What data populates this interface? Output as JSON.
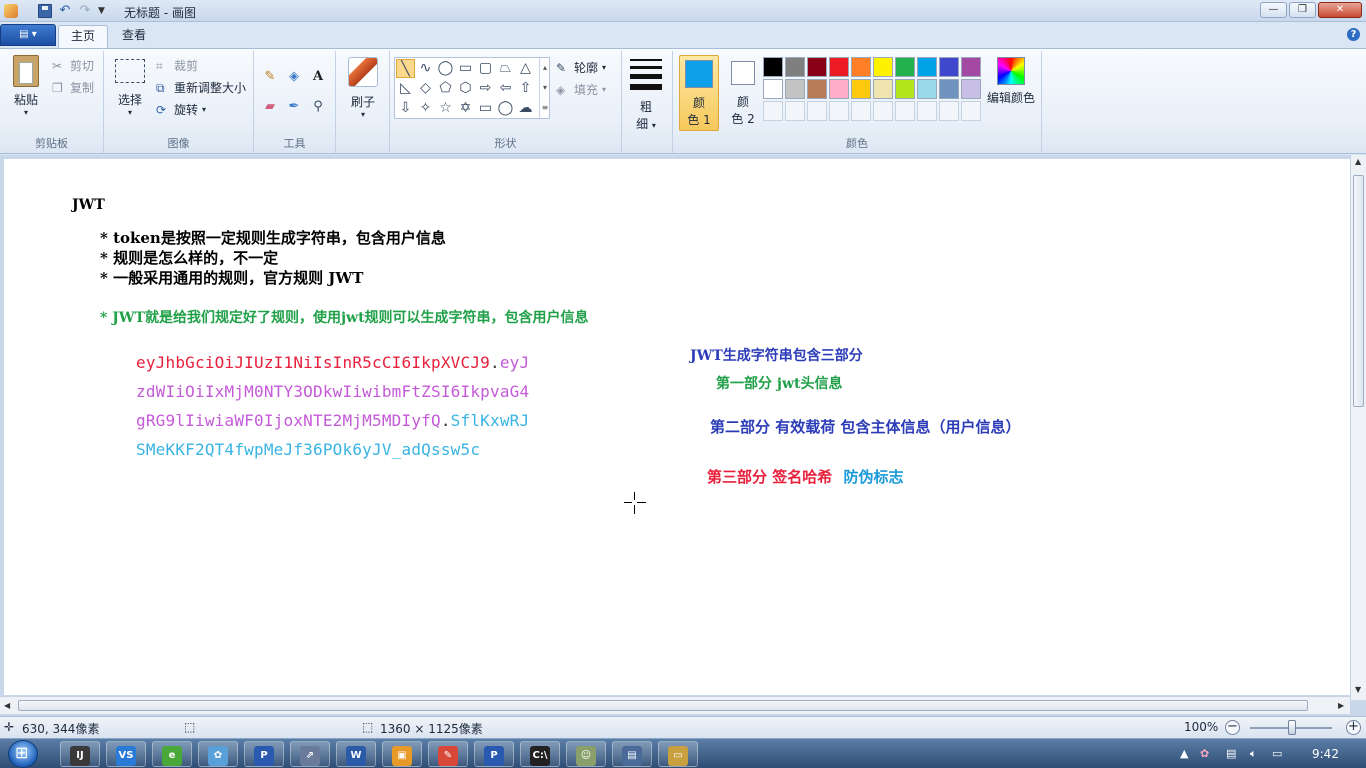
{
  "window": {
    "title": "无标题 - 画图",
    "buttons": {
      "minimize": "—",
      "maximize": "❐",
      "close": "✕"
    }
  },
  "tabs": [
    {
      "label": "主页",
      "active": true
    },
    {
      "label": "查看",
      "active": false
    }
  ],
  "ribbon": {
    "clipboard": {
      "paste": "粘贴",
      "cut": "剪切",
      "copy": "复制",
      "group": "剪贴板"
    },
    "image": {
      "select": "选择",
      "crop": "裁剪",
      "resize": "重新调整大小",
      "rotate": "旋转",
      "group": "图像"
    },
    "tools": {
      "group": "工具",
      "text_tool": "A"
    },
    "brush": {
      "label": "刷子"
    },
    "shapes": {
      "outline": "轮廓",
      "fill": "填充",
      "group": "形状"
    },
    "size": {
      "label_line1": "粗",
      "label_line2": "细"
    },
    "colors": {
      "color1_line1": "颜",
      "color1_line2": "色 1",
      "color2_line1": "颜",
      "color2_line2": "色 2",
      "edit": "编辑颜色",
      "group": "颜色",
      "color1_value": "#0ea0e8",
      "color2_value": "#ffffff",
      "palette_row1": [
        "#000000",
        "#7f7f7f",
        "#880015",
        "#ed1c24",
        "#ff7f27",
        "#fff200",
        "#22b14c",
        "#00a2e8",
        "#3f48cc",
        "#a349a4"
      ],
      "palette_row2": [
        "#ffffff",
        "#c3c3c3",
        "#b97a57",
        "#ffaec9",
        "#ffc90e",
        "#efe4b0",
        "#b5e61d",
        "#99d9ea",
        "#7092be",
        "#c8bfe7"
      ]
    }
  },
  "canvas": {
    "heading": "JWT",
    "bullets": [
      "* token是按照一定规则生成字符串，包含用户信息",
      "* 规则是怎么样的，不一定",
      "* 一般采用通用的规则，官方规则 JWT"
    ],
    "green_bullet": "* JWT就是给我们规定好了规则，使用jwt规则可以生成字符串，包含用户信息",
    "token": {
      "line1_red": "eyJhbGciOiJIUzI1NiIsInR5cCI6IkpXVCJ9",
      "line1_dot": ".",
      "line1_purple": "eyJ",
      "line2_purple": "zdWIiOiIxMjM0NTY3ODkwIiwibmFtZSI6IkpvaG4",
      "line3_purple": "gRG9lIiwiaWF0IjoxNTE2MjM5MDIyfQ",
      "line3_dot": ".",
      "line3_cyan": "SflKxwRJ",
      "line4_cyan": "SMeKKF2QT4fwpMeJf36POk6yJV_adQssw5c"
    },
    "explain": {
      "title": "JWT生成字符串包含三部分",
      "part1": "第一部分 jwt头信息",
      "part2": "第二部分 有效载荷 包含主体信息（用户信息）",
      "part3_label": "第三部分 签名哈希",
      "part3_note": "防伪标志"
    },
    "colors": {
      "red": "#e8203c",
      "purple": "#c45ad8",
      "cyan": "#38b4e4",
      "green": "#20a048",
      "blue": "#2c3cb8",
      "sky": "#1a9ad8"
    }
  },
  "status": {
    "cursor_pos": "630, 344像素",
    "canvas_size": "1360 × 1125像素",
    "zoom": "100%"
  },
  "taskbar": {
    "clock": "9:42",
    "items": [
      "IJ",
      "VS",
      "e",
      "✿",
      "P",
      "⇗",
      "W",
      "▣",
      "✎",
      "P",
      "C:\\",
      "☺",
      "▤",
      "▭"
    ]
  }
}
